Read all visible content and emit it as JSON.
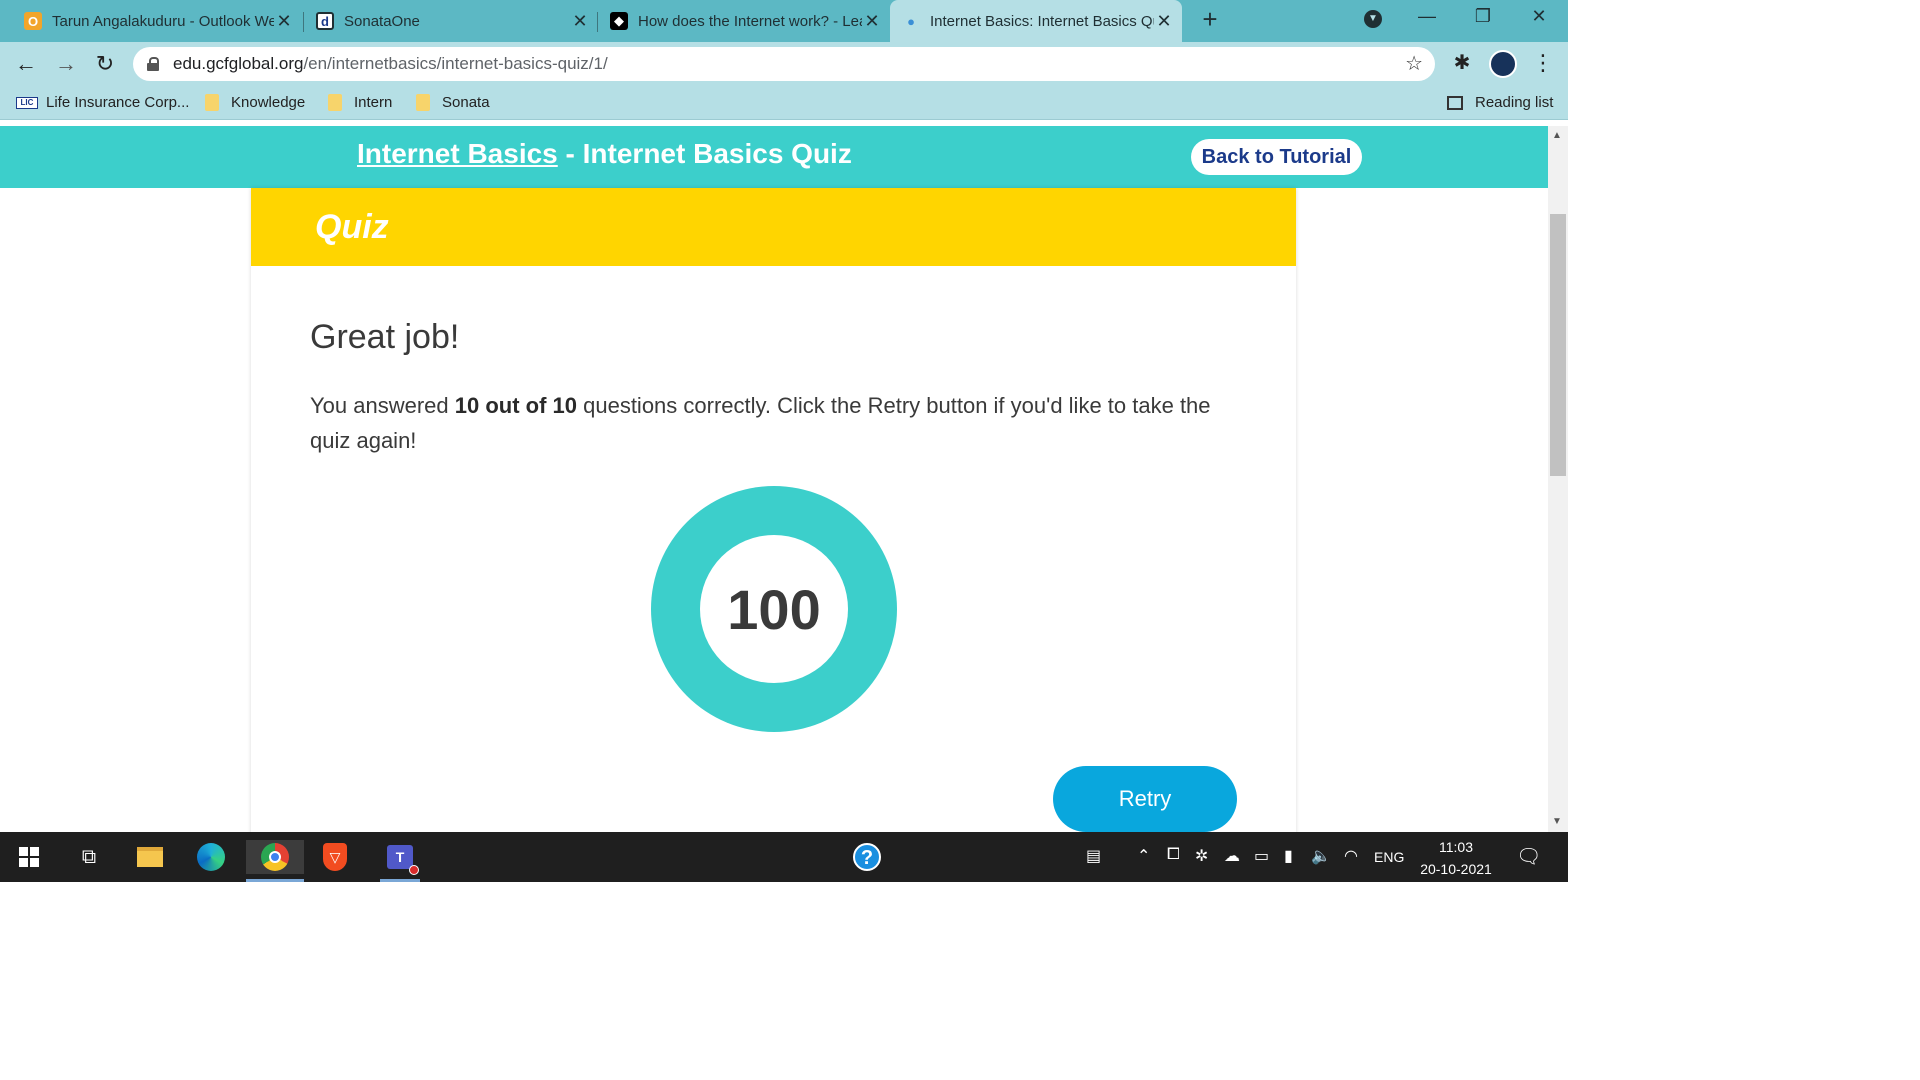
{
  "tabs": [
    {
      "title": "Tarun Angalakuduru - Outlook Web",
      "icon": "outlook-icon",
      "active": false
    },
    {
      "title": "SonataOne",
      "icon": "sonataone-icon",
      "active": false
    },
    {
      "title": "How does the Internet work? - Learn",
      "icon": "mdn-icon",
      "active": false
    },
    {
      "title": "Internet Basics: Internet Basics Quiz",
      "icon": "gcf-icon",
      "active": true
    }
  ],
  "address_bar": {
    "domain": "edu.gcfglobal.org",
    "path": "/en/internetbasics/internet-basics-quiz/1/"
  },
  "bookmarks": [
    {
      "label": "Life Insurance Corp...",
      "icon": "lic-icon"
    },
    {
      "label": "Knowledge",
      "icon": "folder-icon"
    },
    {
      "label": "Intern",
      "icon": "folder-icon"
    },
    {
      "label": "Sonata",
      "icon": "folder-icon"
    }
  ],
  "reading_list": "Reading list",
  "header": {
    "course": "Internet Basics",
    "separator": " - ",
    "lesson": "Internet Basics Quiz",
    "back_button": "Back to Tutorial"
  },
  "quiz": {
    "banner": "Quiz",
    "result_title": "Great job!",
    "message_prefix": "You answered ",
    "score_text": "10 out of 10",
    "message_suffix": " questions correctly. Click the Retry button if you'd like to take the quiz again!",
    "score_percent": "100",
    "retry_button": "Retry"
  },
  "taskbar": {
    "language": "ENG",
    "time": "11:03",
    "date": "20-10-2021"
  },
  "colors": {
    "header": "#3ccfcb",
    "quiz_banner": "#ffd500",
    "retry": "#09a7dd",
    "back_button_text": "#1b3a8a"
  }
}
